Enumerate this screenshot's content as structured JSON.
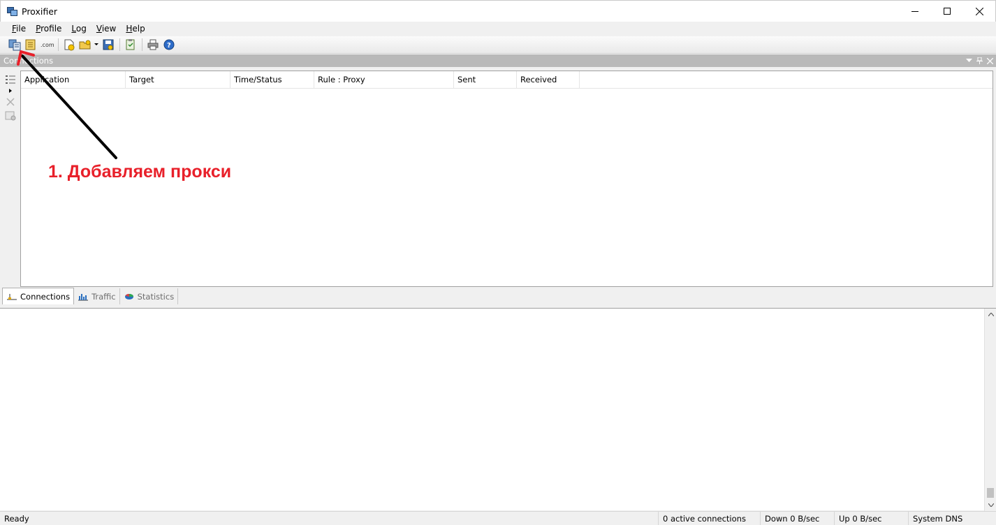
{
  "window": {
    "title": "Proxifier"
  },
  "menu": [
    {
      "label": "File",
      "key": "F",
      "rest": "ile"
    },
    {
      "label": "Profile",
      "key": "P",
      "rest": "rofile"
    },
    {
      "label": "Log",
      "key": "L",
      "rest": "og"
    },
    {
      "label": "View",
      "key": "V",
      "rest": "iew"
    },
    {
      "label": "Help",
      "key": "H",
      "rest": "elp"
    }
  ],
  "toolbar": {
    "buttons": [
      "proxy-servers-icon",
      "proxification-rules-icon",
      "name-resolution-icon",
      "new-profile-icon",
      "open-profile-icon",
      "save-profile-icon",
      "profile-options-icon",
      "print-icon",
      "help-icon"
    ]
  },
  "panel": {
    "caption": "Connections"
  },
  "connections": {
    "columns": [
      {
        "label": "Application"
      },
      {
        "label": "Target"
      },
      {
        "label": "Time/Status"
      },
      {
        "label": "Rule : Proxy"
      },
      {
        "label": "Sent"
      },
      {
        "label": "Received"
      }
    ]
  },
  "tabs": [
    {
      "label": "Connections",
      "icon": "connections-icon",
      "active": true
    },
    {
      "label": "Traffic",
      "icon": "traffic-chart-icon",
      "active": false
    },
    {
      "label": "Statistics",
      "icon": "statistics-pie-icon",
      "active": false
    }
  ],
  "status": {
    "ready": "Ready",
    "active_connections": "0 active connections",
    "down": "Down 0 B/sec",
    "up": "Up 0 B/sec",
    "dns": "System DNS"
  },
  "annotation": {
    "text": "1. Добавляем прокси",
    "color": "#e8202a"
  }
}
